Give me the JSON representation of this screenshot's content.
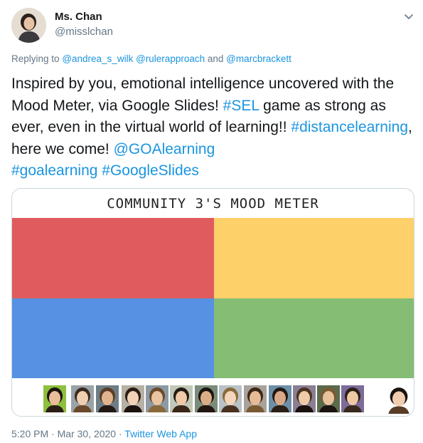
{
  "author": {
    "display_name": "Ms. Chan",
    "handle": "@misslchan"
  },
  "reply": {
    "prefix": "Replying to",
    "mention_1": "@andrea_s_wilk",
    "mention_2": "@rulerapproach",
    "conjunction": "and",
    "mention_3": "@marcbrackett"
  },
  "tweet": {
    "text_1": "Inspired by you, emotional intelligence uncovered with the Mood Meter, via Google Slides! ",
    "hashtag_sel": "#SEL",
    "text_2": " game as strong as ever, even in the virtual world of learning!! ",
    "hashtag_distance": "#distancelearning",
    "text_3": ", here we come! ",
    "mention_goa": "@GOAlearning",
    "hashtag_goa": "#goalearning",
    "hashtag_slides": "#GoogleSlides"
  },
  "media": {
    "slide_title": "COMMUNITY 3'S MOOD METER",
    "quadrant_colors": [
      "#e05b5e",
      "#fdd06a",
      "#5691e3",
      "#85bd74"
    ]
  },
  "meta": {
    "time": "5:20 PM",
    "separator_1": " · ",
    "date": "Mar 30, 2020",
    "separator_2": " · ",
    "source": "Twitter Web App"
  },
  "icons": {
    "more": "chevron-down-icon"
  }
}
